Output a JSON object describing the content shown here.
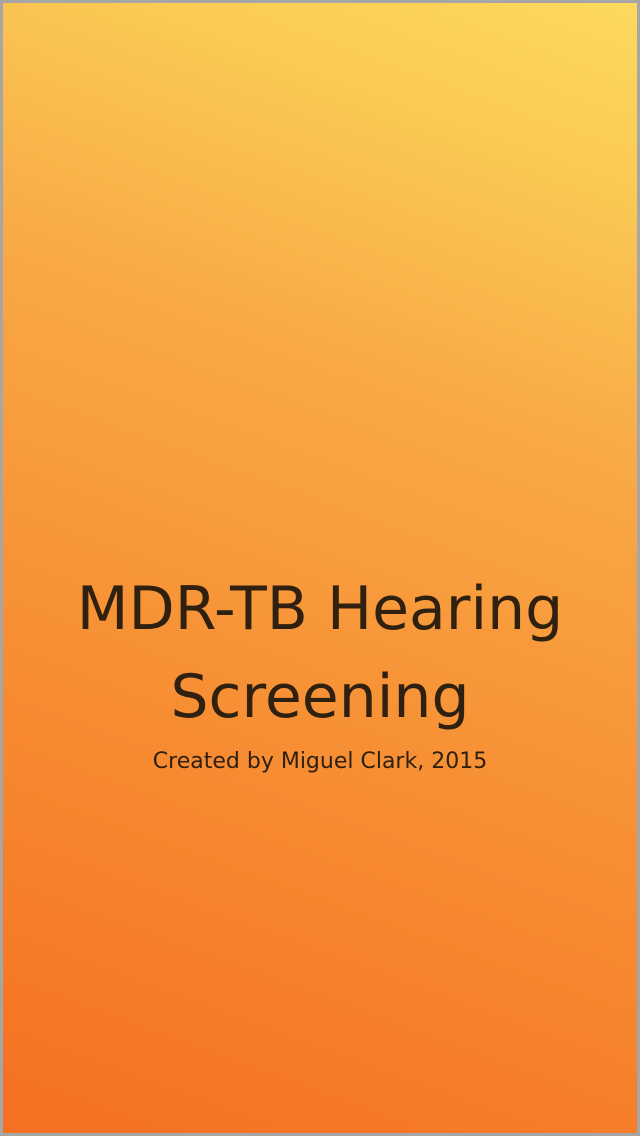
{
  "splash": {
    "title_line1": "MDR-TB Hearing",
    "title_line2": "Screening",
    "credit": "Created by Miguel Clark, 2015"
  },
  "colors": {
    "gradient_top_right": "#fcd95e",
    "gradient_bottom_left": "#f56f22",
    "text": "#2f2010",
    "frame_border": "#a6a6a6"
  }
}
